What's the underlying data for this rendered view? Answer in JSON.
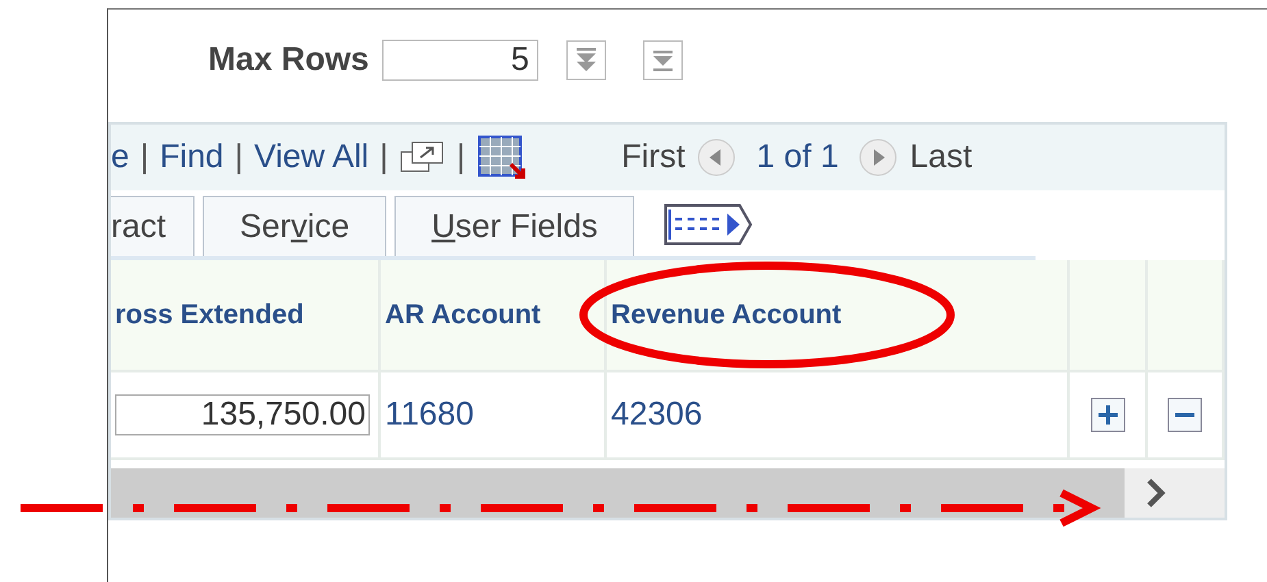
{
  "max_rows": {
    "label": "Max Rows",
    "value": "5"
  },
  "toolbar": {
    "links": [
      "e",
      "Find",
      "View All"
    ],
    "separator": "|",
    "first": "First",
    "counter": "1 of 1",
    "last": "Last"
  },
  "tabs": [
    {
      "label": "ract",
      "selected": false
    },
    {
      "label_parts": [
        {
          "text": "Ser",
          "underlined": false
        },
        {
          "text": "v",
          "underlined": true
        },
        {
          "text": "ice",
          "underlined": false
        }
      ],
      "selected": false
    },
    {
      "label_parts": [
        {
          "text": "U",
          "underlined": true
        },
        {
          "text": "ser Fields",
          "underlined": false
        }
      ],
      "selected": false
    }
  ],
  "table": {
    "columns": [
      "ross Extended",
      "AR Account",
      "Revenue Account"
    ],
    "rows": [
      {
        "gross_extended": "135,750.00",
        "ar_account": "11680",
        "revenue_account": "42306"
      }
    ]
  }
}
